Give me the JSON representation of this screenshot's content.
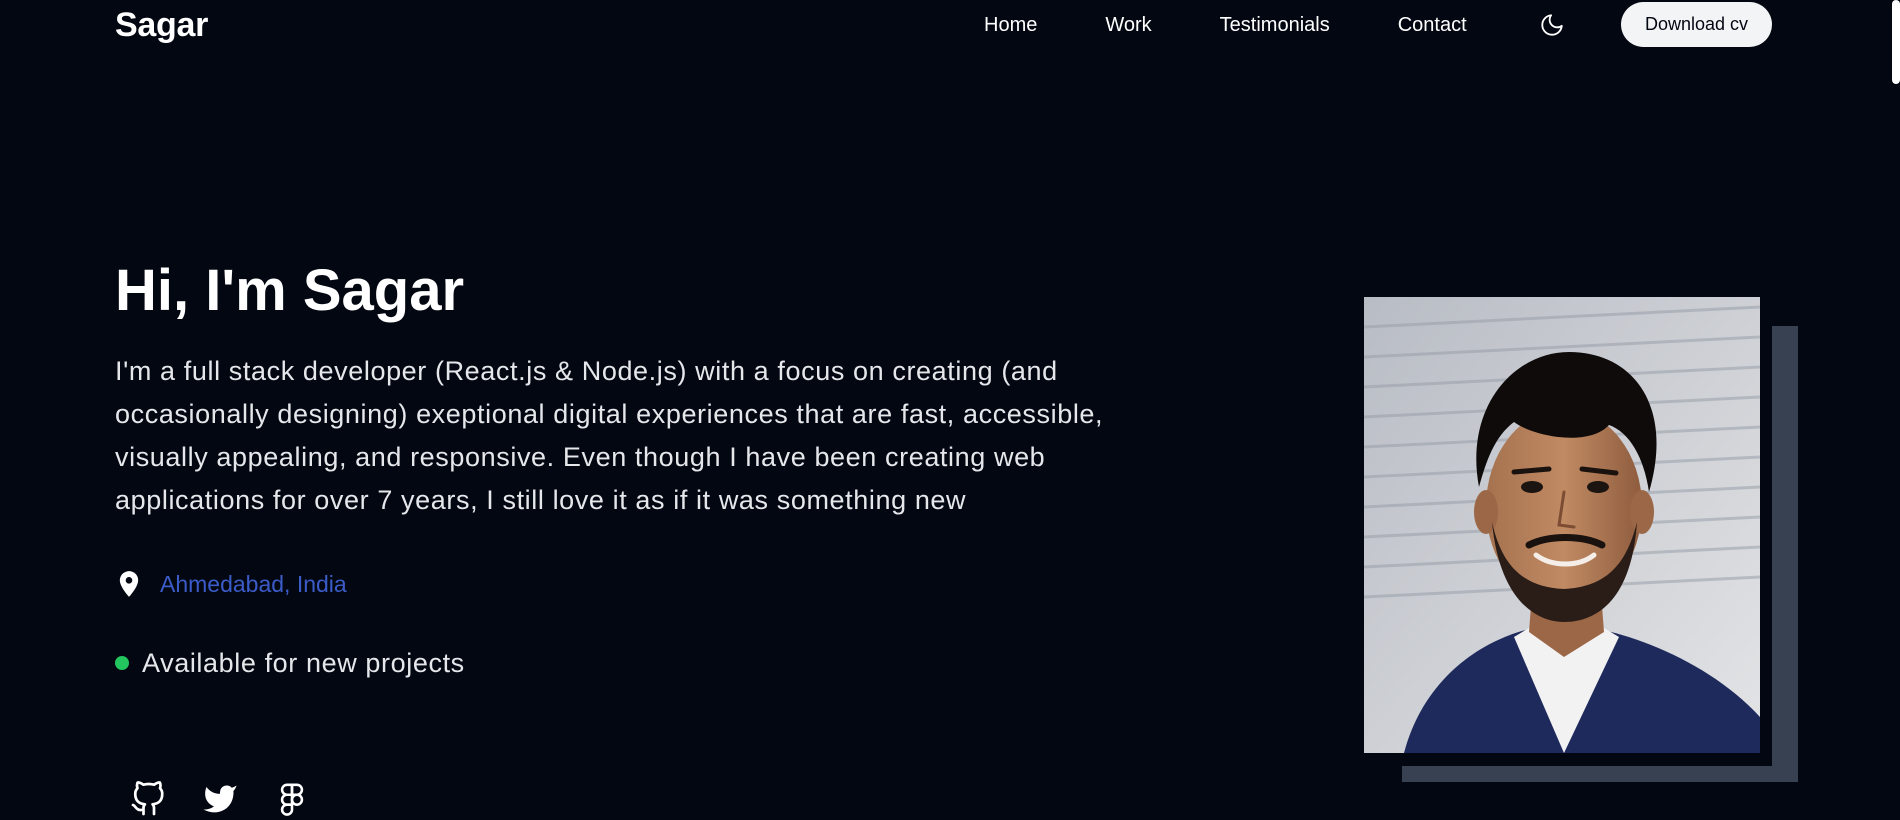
{
  "header": {
    "logo": "Sagar",
    "nav": [
      "Home",
      "Work",
      "Testimonials",
      "Contact"
    ],
    "theme_toggle_icon": "moon-icon",
    "download_label": "Download cv"
  },
  "hero": {
    "title": "Hi, I'm Sagar",
    "description": "I'm a full stack developer (React.js & Node.js) with a focus on creating (and occasionally designing) exeptional digital experiences that are fast, accessible, visually appealing, and responsive. Even though I have been creating web applications for over 7 years, I still love it as if it was something new",
    "location_icon": "map-pin-icon",
    "location": "Ahmedabad, India",
    "availability": "Available for new projects",
    "availability_color": "#22c55e",
    "location_color": "#3b5cc8"
  },
  "socials": [
    {
      "icon": "github-icon"
    },
    {
      "icon": "twitter-icon"
    },
    {
      "icon": "figma-icon"
    }
  ],
  "portrait": {
    "icon": "profile-photo"
  },
  "colors": {
    "background": "#030712",
    "button_bg": "#f3f4f6",
    "shadow_block": "#374151"
  }
}
